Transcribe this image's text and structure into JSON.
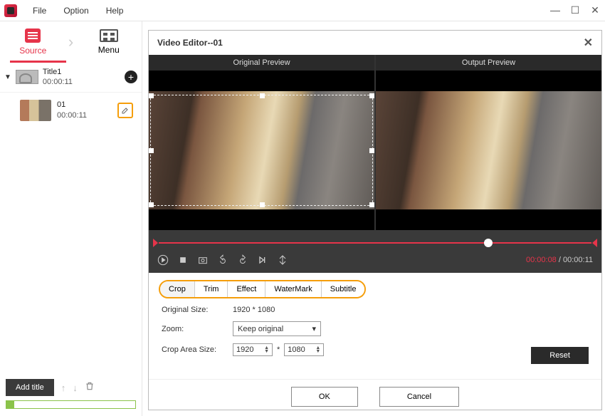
{
  "menubar": {
    "items": [
      "File",
      "Option",
      "Help"
    ]
  },
  "left_tabs": {
    "source": "Source",
    "menu": "Menu"
  },
  "titles": [
    {
      "name": "Title1",
      "duration": "00:00:11"
    }
  ],
  "clips": [
    {
      "name": "01",
      "duration": "00:00:11"
    }
  ],
  "add_title_label": "Add title",
  "dialog": {
    "title": "Video Editor--01",
    "preview_original": "Original Preview",
    "preview_output": "Output Preview",
    "time_current": "00:00:08",
    "time_total": "00:00:11",
    "tabs": [
      "Crop",
      "Trim",
      "Effect",
      "WaterMark",
      "Subtitle"
    ],
    "form": {
      "original_size_label": "Original Size:",
      "original_size_value": "1920 * 1080",
      "zoom_label": "Zoom:",
      "zoom_value": "Keep original",
      "crop_area_label": "Crop Area Size:",
      "crop_w": "1920",
      "crop_h": "1080"
    },
    "reset_label": "Reset",
    "ok_label": "OK",
    "cancel_label": "Cancel"
  }
}
